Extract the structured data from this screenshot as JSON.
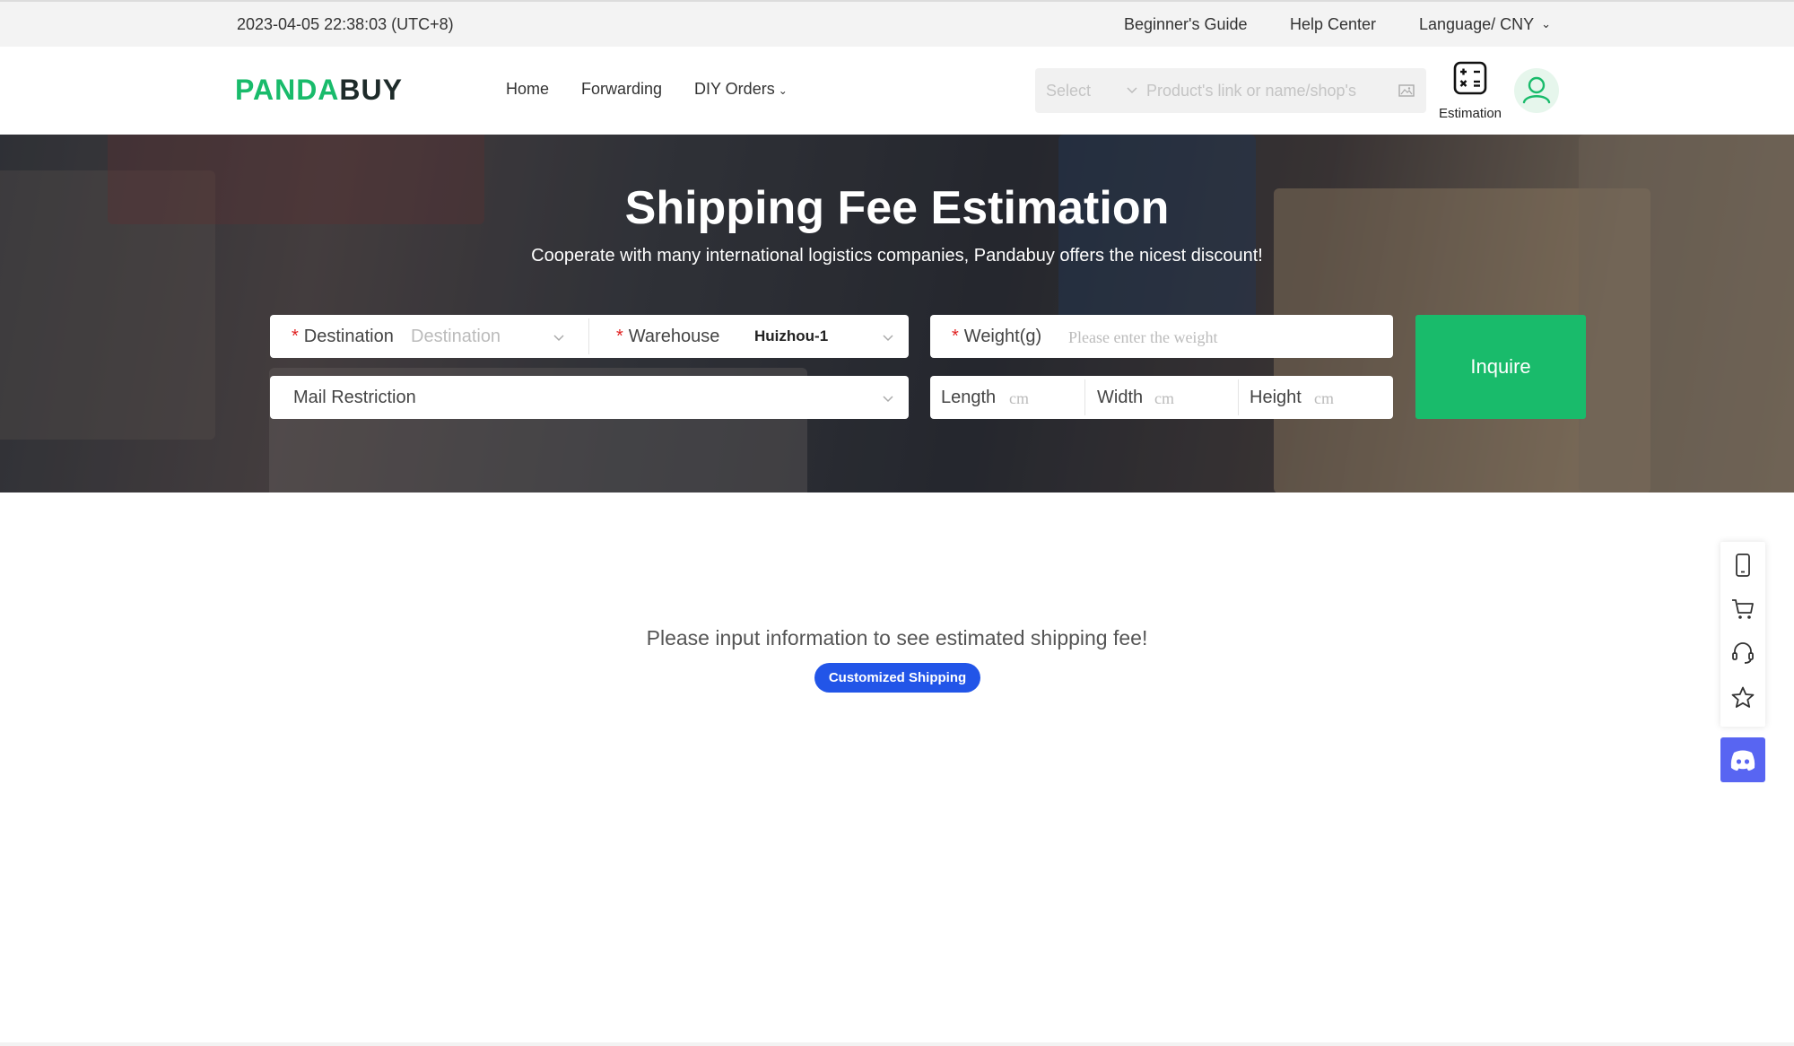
{
  "topbar": {
    "datetime": "2023-04-05 22:38:03 (UTC+8)",
    "beginners_guide": "Beginner's Guide",
    "help_center": "Help Center",
    "language_currency": "Language/ CNY"
  },
  "header": {
    "logo_part1": "PANDA",
    "logo_part2": "BUY",
    "nav": {
      "home": "Home",
      "forwarding": "Forwarding",
      "diy_orders": "DIY Orders"
    },
    "search": {
      "select_placeholder": "Select",
      "input_placeholder": "Product's link or name/shop's"
    },
    "estimation_label": "Estimation"
  },
  "hero": {
    "title": "Shipping Fee Estimation",
    "subtitle": "Cooperate with many international logistics companies, Pandabuy offers the nicest discount!",
    "form": {
      "required_mark": "*",
      "destination_label": "Destination",
      "destination_placeholder": "Destination",
      "warehouse_label": "Warehouse",
      "warehouse_value": "Huizhou-1",
      "weight_label": "Weight(g)",
      "weight_placeholder": "Please enter the weight",
      "mail_restriction_label": "Mail Restriction",
      "length_label": "Length",
      "width_label": "Width",
      "height_label": "Height",
      "unit_placeholder": "cm",
      "inquire_button": "Inquire"
    }
  },
  "main": {
    "message": "Please input information to see estimated shipping fee!",
    "customized_shipping": "Customized Shipping"
  },
  "sidebar": {
    "items": [
      "mobile-icon",
      "cart-icon",
      "headset-icon",
      "star-icon"
    ],
    "discord": "discord-icon"
  },
  "colors": {
    "brand_green": "#19bb6b",
    "logo_dark": "#1e2b2a",
    "accent_blue": "#2255e8",
    "discord": "#5865f2",
    "required_red": "#e02020"
  }
}
